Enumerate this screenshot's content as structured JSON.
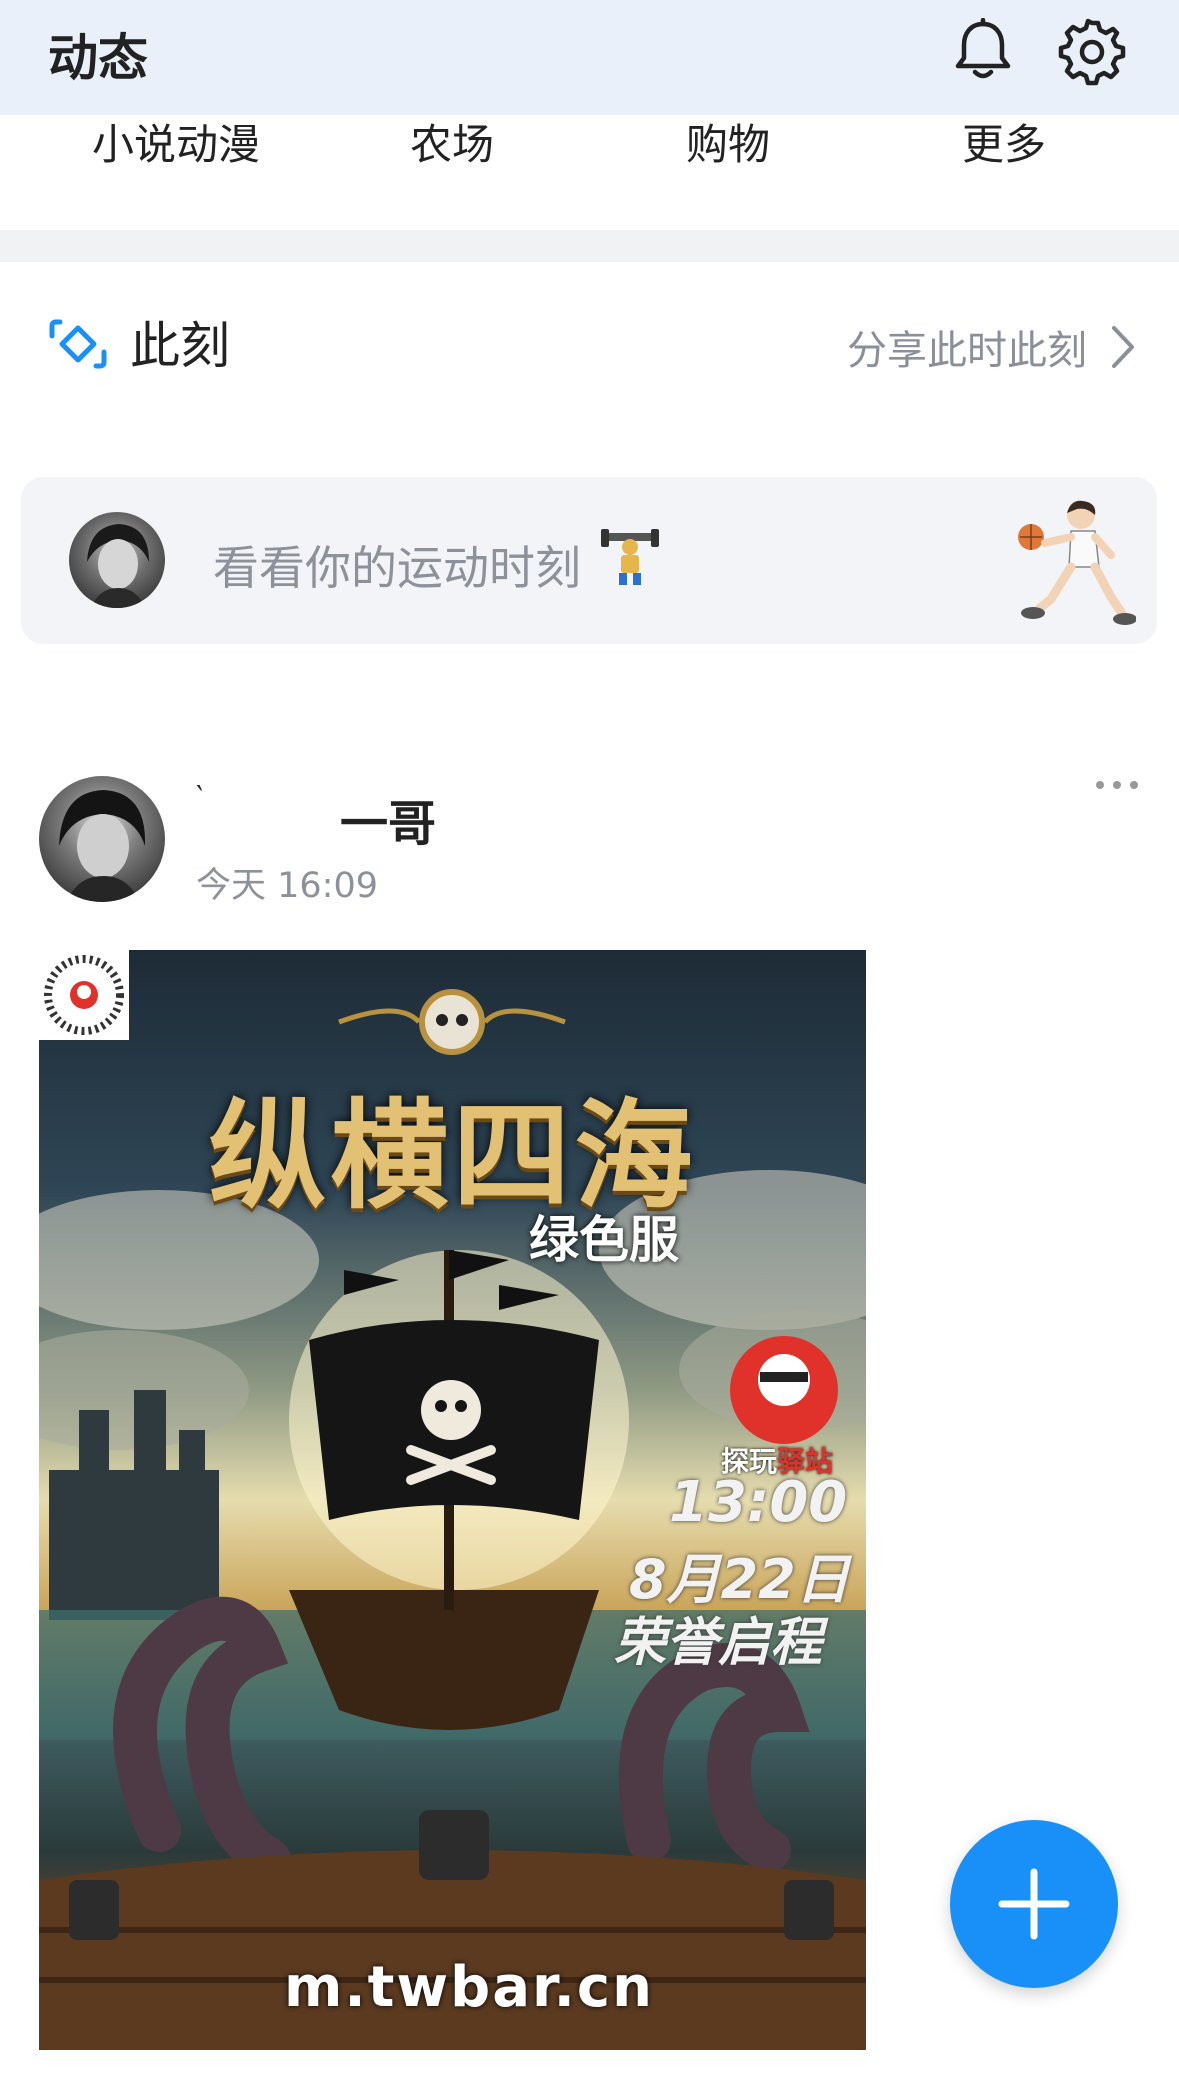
{
  "header": {
    "title": "动态"
  },
  "categories": [
    "小说动漫",
    "农场",
    "购物",
    "更多"
  ],
  "moment": {
    "title": "此刻",
    "share_label": "分享此时此刻"
  },
  "sport_prompt": {
    "placeholder": "看看你的运动时刻"
  },
  "post": {
    "quote_mark": "‵",
    "author": "一哥",
    "time": "今天 16:09",
    "poster": {
      "title": "纵横四海",
      "subtitle": "绿色服",
      "brand_a": "探玩",
      "brand_b": "驿站",
      "time": "13:00",
      "date": "8月22日",
      "honor": "荣誉启程",
      "url": "m.twbar.cn"
    }
  },
  "colors": {
    "accent": "#1890f7",
    "header_bg": "#eaf0fa",
    "card_bg": "#f3f4f7"
  },
  "icons": [
    "bell-icon",
    "gear-icon",
    "moment-icon",
    "chevron-right-icon",
    "more-icon",
    "plus-icon"
  ]
}
